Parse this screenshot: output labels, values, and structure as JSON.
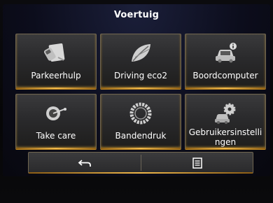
{
  "header": {
    "title": "Voertuig"
  },
  "tiles": [
    {
      "label": "Parkeerhulp",
      "icon": "parking-assist-icon"
    },
    {
      "label": "Driving eco2",
      "icon": "eco-leaf-icon"
    },
    {
      "label": "Boordcomputer",
      "icon": "trip-computer-icon"
    },
    {
      "label": "Take care",
      "icon": "take-care-icon"
    },
    {
      "label": "Bandendruk",
      "icon": "tire-pressure-icon"
    },
    {
      "label_line1": "Gebruikersinstelli",
      "label_line2": "ngen",
      "icon": "vehicle-settings-icon"
    }
  ],
  "bottom_bar": {
    "back": {
      "icon": "back-arrow-icon"
    },
    "menu": {
      "icon": "list-menu-icon"
    }
  },
  "colors": {
    "accent": "#e8b04a",
    "tile": "#2e2e30",
    "text": "#ffffff",
    "background": "#0c0d1c"
  }
}
